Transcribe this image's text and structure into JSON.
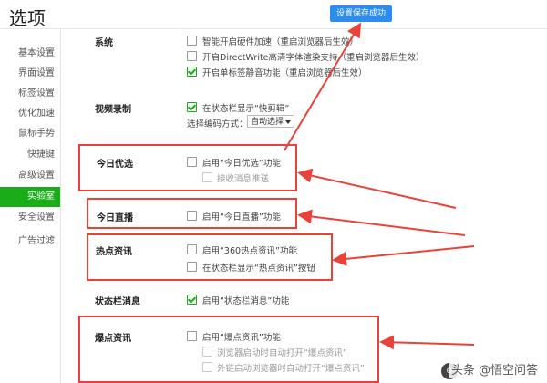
{
  "header": {
    "title": "选项",
    "toast": "设置保存成功"
  },
  "sidebar": {
    "items": [
      {
        "label": "基本设置"
      },
      {
        "label": "界面设置"
      },
      {
        "label": "标签设置"
      },
      {
        "label": "优化加速"
      },
      {
        "label": "鼠标手势"
      },
      {
        "label": "快捷键"
      },
      {
        "label": "高级设置"
      },
      {
        "label": "实验室"
      },
      {
        "label": "安全设置"
      },
      {
        "label": "广告过滤"
      }
    ],
    "active": "实验室"
  },
  "sections": {
    "system": {
      "label": "系统",
      "options": [
        {
          "text": "智能开启硬件加速（重启浏览器后生效）",
          "checked": false
        },
        {
          "text": "开启DirectWrite高清字体渲染支持（重启浏览器后生效）",
          "checked": false
        },
        {
          "text": "开启单标签静音功能（重启浏览器后生效）",
          "checked": true
        }
      ]
    },
    "video": {
      "label": "视频录制",
      "option": "在状态栏显示“快剪辑”",
      "checked": true,
      "encode_label": "选择编码方式：",
      "encode_value": "自动选择"
    },
    "today_pick": {
      "label": "今日优选",
      "option": "启用“今日优选”功能",
      "sub": "接收消息推送"
    },
    "today_live": {
      "label": "今日直播",
      "option": "启用“今日直播”功能"
    },
    "hot_news": {
      "label": "热点资讯",
      "options": [
        "启用“360热点资讯”功能",
        "在状态栏显示“热点资讯”按钮"
      ]
    },
    "status_msg": {
      "label": "状态栏消息",
      "option": "启用“状态栏消息”功能",
      "checked": true
    },
    "burst": {
      "label": "爆点资讯",
      "option": "启用“爆点资讯”功能",
      "subs": [
        "浏览器启动时自动打开“爆点资讯”",
        "外链启动浏览器时自动打开“爆点资讯”"
      ]
    }
  },
  "watermark": {
    "text": "头条 @悟空问答"
  },
  "colors": {
    "accent_green": "#1aad19",
    "annotation_red": "#e8423a",
    "toast_blue": "#2d8cf0"
  }
}
